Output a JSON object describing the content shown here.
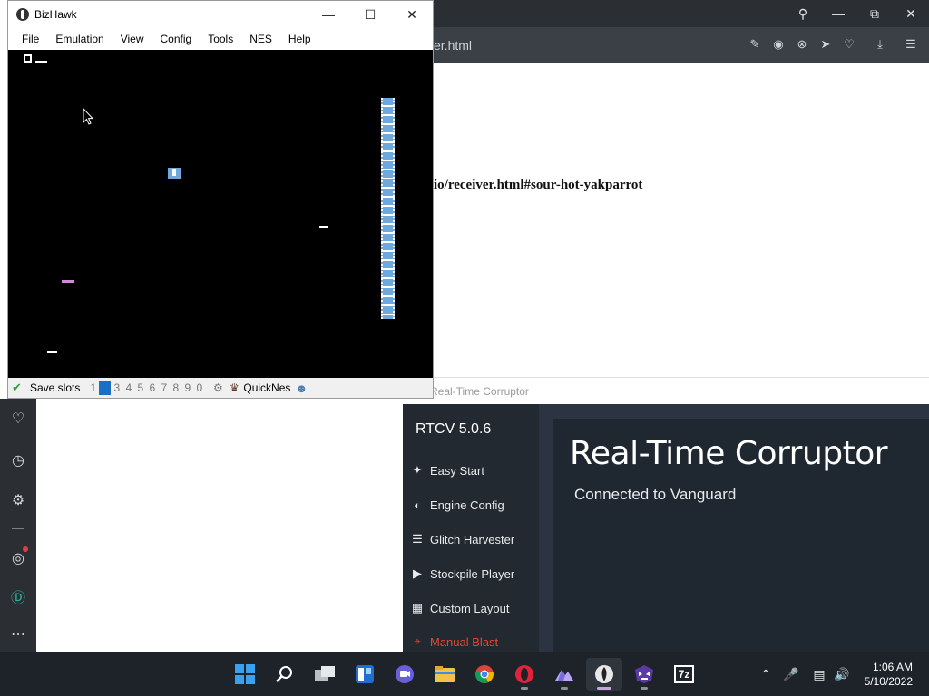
{
  "browser": {
    "address_fragment": "er.html",
    "page_link_text": "io/receiver.html#sour-hot-yakparrot",
    "controls": [
      "search-icon",
      "minimize-icon",
      "restore-icon",
      "close-icon"
    ],
    "toolbar_icons": [
      "edit-icon",
      "camera-icon",
      "close-circle-icon",
      "send-icon",
      "heart-icon",
      "download-icon",
      "menu-icon"
    ],
    "sidebar_icons": [
      "heart-icon",
      "clock-icon",
      "gear-icon",
      "lightbulb-icon",
      "account-icon",
      "more-icon"
    ]
  },
  "bizhawk": {
    "title": "BizHawk",
    "menu": [
      "File",
      "Emulation",
      "View",
      "Config",
      "Tools",
      "NES",
      "Help"
    ],
    "status": {
      "save_slots_label": "Save slots",
      "slots": [
        "1",
        "2",
        "3",
        "4",
        "5",
        "6",
        "7",
        "8",
        "9",
        "0"
      ],
      "active_slot": "2",
      "core": "QuickNes"
    }
  },
  "rtcv": {
    "window_title": "Real-Time Corruptor",
    "version": "RTCV 5.0.6",
    "nav": [
      {
        "label": "Easy Start",
        "icon": "wand-icon"
      },
      {
        "label": "Engine Config",
        "icon": "gauge-icon"
      },
      {
        "label": "Glitch Harvester",
        "icon": "layers-icon"
      },
      {
        "label": "Stockpile Player",
        "icon": "play-icon"
      },
      {
        "label": "Custom Layout",
        "icon": "grid-icon"
      },
      {
        "label": "Manual Blast",
        "icon": "target-icon"
      }
    ],
    "heading": "Real-Time Corruptor",
    "status": "Connected to Vanguard",
    "accent_color": "#e04a32"
  },
  "taskbar": {
    "apps": [
      "start-icon",
      "search-icon",
      "task-view-icon",
      "widgets-icon",
      "teams-chat-icon",
      "file-explorer-icon",
      "chrome-icon",
      "opera-icon",
      "game-app-icon",
      "bizhawk-icon",
      "rtcv-icon",
      "7zip-icon"
    ],
    "seven_zip_label": "7z",
    "time": "1:06 AM",
    "date": "5/10/2022"
  }
}
